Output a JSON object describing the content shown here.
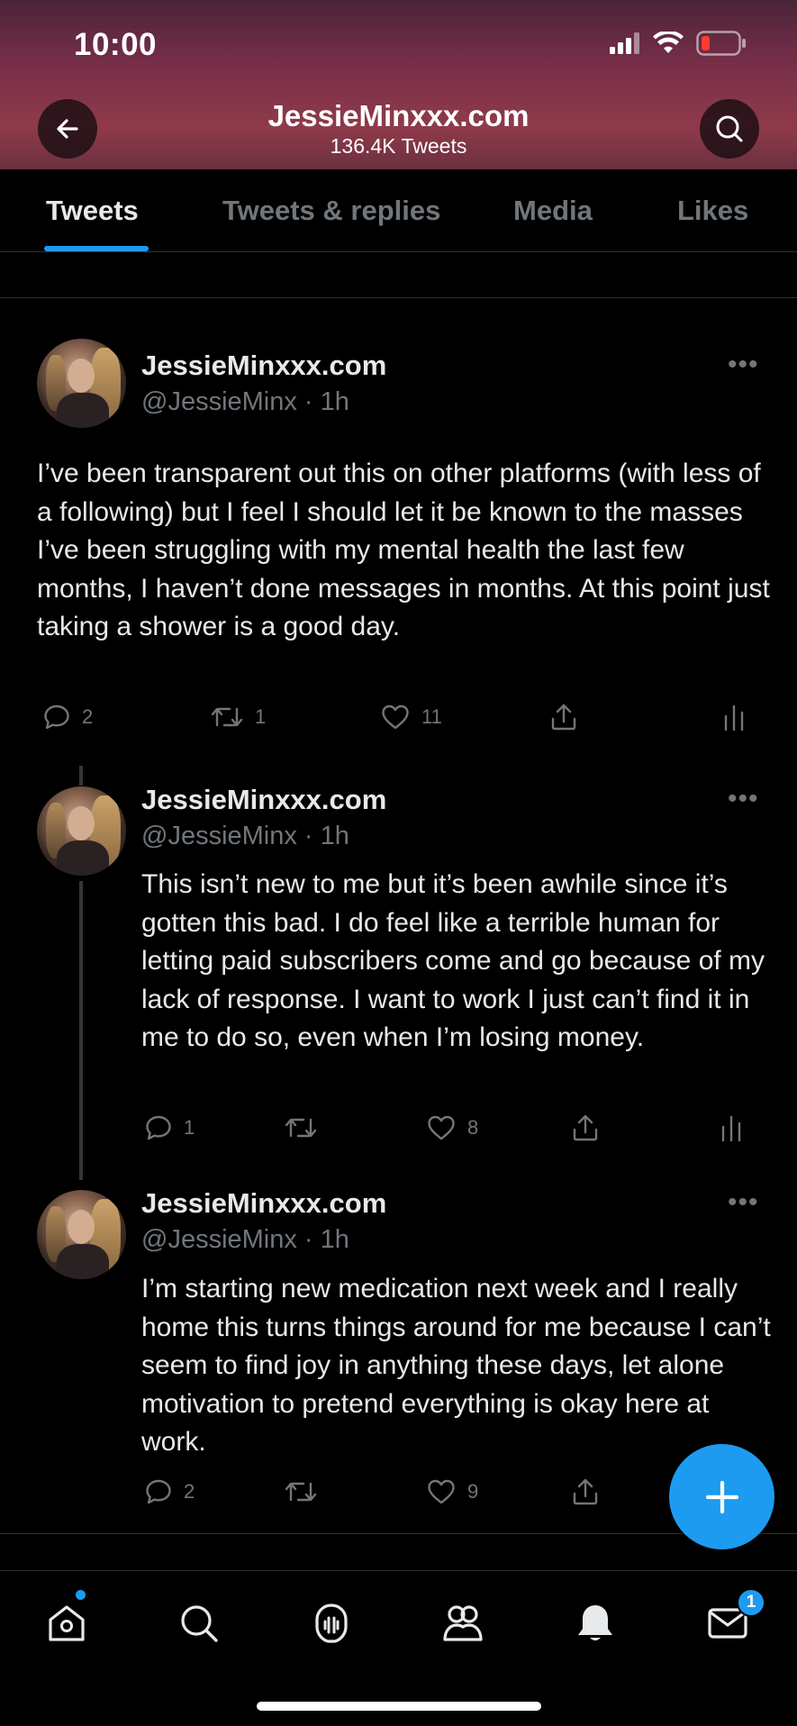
{
  "status_bar": {
    "time": "10:00"
  },
  "header": {
    "title": "JessieMinxxx.com",
    "subtitle": "136.4K Tweets"
  },
  "tabs": [
    {
      "label": "Tweets",
      "active": true
    },
    {
      "label": "Tweets & replies",
      "active": false
    },
    {
      "label": "Media",
      "active": false
    },
    {
      "label": "Likes",
      "active": false
    }
  ],
  "tweets": [
    {
      "name": "JessieMinxxx.com",
      "handle": "@JessieMinx · 1h",
      "text": "I’ve been transparent out this on other platforms (with less of a following) but I feel I should let it be known to the masses I’ve been struggling with my mental health the last few months, I haven’t done messages in months. At this point just taking a shower is a good day.",
      "replies": "2",
      "retweets": "1",
      "likes": "11"
    },
    {
      "name": "JessieMinxxx.com",
      "handle": "@JessieMinx · 1h",
      "text": "This isn’t new to me but it’s been awhile since it’s gotten this bad. I do feel like a terrible human for letting paid subscribers come and go because of my lack of response. I want to work I just can’t find it in me to do so, even when I’m losing money.",
      "replies": "1",
      "retweets": "",
      "likes": "8"
    },
    {
      "name": "JessieMinxxx.com",
      "handle": "@JessieMinx · 1h",
      "text": "I’m starting new medication next week and I really home this turns things around for me because I can’t seem to find joy in anything these days, let alone motivation to pretend everything is okay here at work.",
      "replies": "2",
      "retweets": "",
      "likes": "9"
    }
  ],
  "bottom_nav": {
    "messages_badge": "1"
  },
  "icons": [
    "back-arrow-icon",
    "search-icon",
    "reply-icon",
    "retweet-icon",
    "like-icon",
    "share-icon",
    "analytics-icon",
    "compose-icon",
    "home-icon",
    "explore-icon",
    "spaces-icon",
    "communities-icon",
    "notifications-icon",
    "messages-icon"
  ],
  "colors": {
    "accent": "#1d9bf0",
    "background": "#000000",
    "muted": "#71767b"
  }
}
